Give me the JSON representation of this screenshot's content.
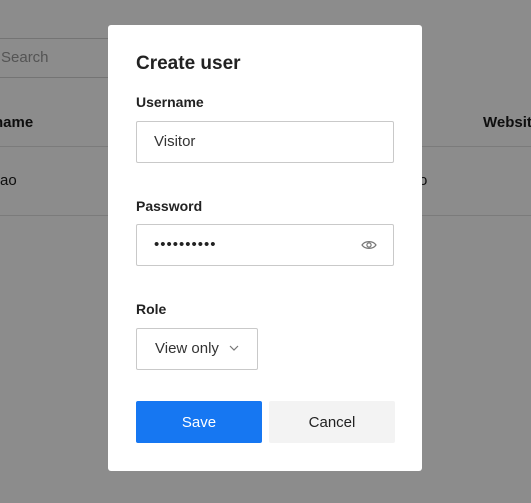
{
  "background": {
    "search": {
      "placeholder": "Search"
    },
    "columns": [
      "name",
      "Websit"
    ],
    "row": {
      "name": "ao",
      "middle": "o"
    }
  },
  "modal": {
    "title": "Create user",
    "username": {
      "label": "Username",
      "value": "Visitor"
    },
    "password": {
      "label": "Password",
      "value": "••••••••••",
      "icon": "eye-icon"
    },
    "role": {
      "label": "Role",
      "value": "View only",
      "icon": "chevron-down-icon"
    },
    "buttons": {
      "save": "Save",
      "cancel": "Cancel"
    }
  },
  "colors": {
    "primary": "#1677f2",
    "overlay": "rgba(0,0,0,0.45)",
    "cancel_bg": "#f3f3f3"
  }
}
